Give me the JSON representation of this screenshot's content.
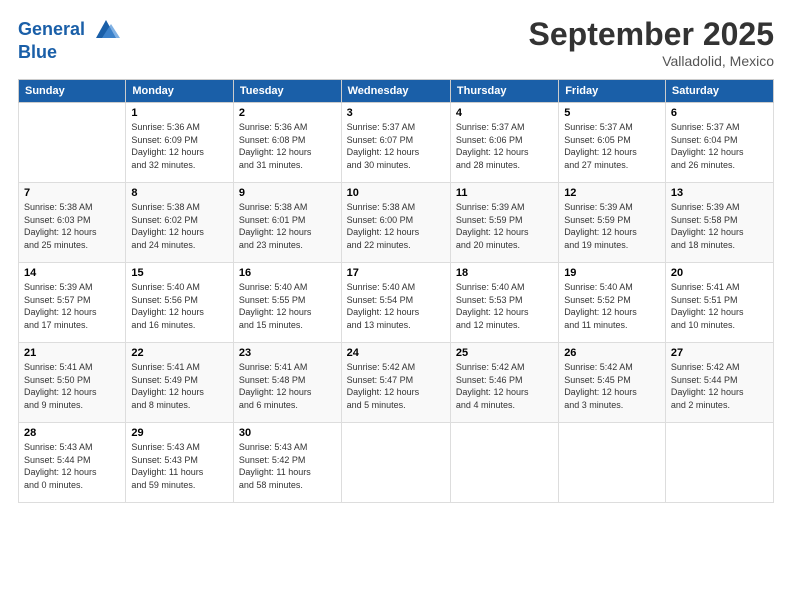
{
  "header": {
    "logo_line1": "General",
    "logo_line2": "Blue",
    "month": "September 2025",
    "location": "Valladolid, Mexico"
  },
  "days_of_week": [
    "Sunday",
    "Monday",
    "Tuesday",
    "Wednesday",
    "Thursday",
    "Friday",
    "Saturday"
  ],
  "weeks": [
    [
      {
        "day": "",
        "info": ""
      },
      {
        "day": "1",
        "info": "Sunrise: 5:36 AM\nSunset: 6:09 PM\nDaylight: 12 hours\nand 32 minutes."
      },
      {
        "day": "2",
        "info": "Sunrise: 5:36 AM\nSunset: 6:08 PM\nDaylight: 12 hours\nand 31 minutes."
      },
      {
        "day": "3",
        "info": "Sunrise: 5:37 AM\nSunset: 6:07 PM\nDaylight: 12 hours\nand 30 minutes."
      },
      {
        "day": "4",
        "info": "Sunrise: 5:37 AM\nSunset: 6:06 PM\nDaylight: 12 hours\nand 28 minutes."
      },
      {
        "day": "5",
        "info": "Sunrise: 5:37 AM\nSunset: 6:05 PM\nDaylight: 12 hours\nand 27 minutes."
      },
      {
        "day": "6",
        "info": "Sunrise: 5:37 AM\nSunset: 6:04 PM\nDaylight: 12 hours\nand 26 minutes."
      }
    ],
    [
      {
        "day": "7",
        "info": "Sunrise: 5:38 AM\nSunset: 6:03 PM\nDaylight: 12 hours\nand 25 minutes."
      },
      {
        "day": "8",
        "info": "Sunrise: 5:38 AM\nSunset: 6:02 PM\nDaylight: 12 hours\nand 24 minutes."
      },
      {
        "day": "9",
        "info": "Sunrise: 5:38 AM\nSunset: 6:01 PM\nDaylight: 12 hours\nand 23 minutes."
      },
      {
        "day": "10",
        "info": "Sunrise: 5:38 AM\nSunset: 6:00 PM\nDaylight: 12 hours\nand 22 minutes."
      },
      {
        "day": "11",
        "info": "Sunrise: 5:39 AM\nSunset: 5:59 PM\nDaylight: 12 hours\nand 20 minutes."
      },
      {
        "day": "12",
        "info": "Sunrise: 5:39 AM\nSunset: 5:59 PM\nDaylight: 12 hours\nand 19 minutes."
      },
      {
        "day": "13",
        "info": "Sunrise: 5:39 AM\nSunset: 5:58 PM\nDaylight: 12 hours\nand 18 minutes."
      }
    ],
    [
      {
        "day": "14",
        "info": "Sunrise: 5:39 AM\nSunset: 5:57 PM\nDaylight: 12 hours\nand 17 minutes."
      },
      {
        "day": "15",
        "info": "Sunrise: 5:40 AM\nSunset: 5:56 PM\nDaylight: 12 hours\nand 16 minutes."
      },
      {
        "day": "16",
        "info": "Sunrise: 5:40 AM\nSunset: 5:55 PM\nDaylight: 12 hours\nand 15 minutes."
      },
      {
        "day": "17",
        "info": "Sunrise: 5:40 AM\nSunset: 5:54 PM\nDaylight: 12 hours\nand 13 minutes."
      },
      {
        "day": "18",
        "info": "Sunrise: 5:40 AM\nSunset: 5:53 PM\nDaylight: 12 hours\nand 12 minutes."
      },
      {
        "day": "19",
        "info": "Sunrise: 5:40 AM\nSunset: 5:52 PM\nDaylight: 12 hours\nand 11 minutes."
      },
      {
        "day": "20",
        "info": "Sunrise: 5:41 AM\nSunset: 5:51 PM\nDaylight: 12 hours\nand 10 minutes."
      }
    ],
    [
      {
        "day": "21",
        "info": "Sunrise: 5:41 AM\nSunset: 5:50 PM\nDaylight: 12 hours\nand 9 minutes."
      },
      {
        "day": "22",
        "info": "Sunrise: 5:41 AM\nSunset: 5:49 PM\nDaylight: 12 hours\nand 8 minutes."
      },
      {
        "day": "23",
        "info": "Sunrise: 5:41 AM\nSunset: 5:48 PM\nDaylight: 12 hours\nand 6 minutes."
      },
      {
        "day": "24",
        "info": "Sunrise: 5:42 AM\nSunset: 5:47 PM\nDaylight: 12 hours\nand 5 minutes."
      },
      {
        "day": "25",
        "info": "Sunrise: 5:42 AM\nSunset: 5:46 PM\nDaylight: 12 hours\nand 4 minutes."
      },
      {
        "day": "26",
        "info": "Sunrise: 5:42 AM\nSunset: 5:45 PM\nDaylight: 12 hours\nand 3 minutes."
      },
      {
        "day": "27",
        "info": "Sunrise: 5:42 AM\nSunset: 5:44 PM\nDaylight: 12 hours\nand 2 minutes."
      }
    ],
    [
      {
        "day": "28",
        "info": "Sunrise: 5:43 AM\nSunset: 5:44 PM\nDaylight: 12 hours\nand 0 minutes."
      },
      {
        "day": "29",
        "info": "Sunrise: 5:43 AM\nSunset: 5:43 PM\nDaylight: 11 hours\nand 59 minutes."
      },
      {
        "day": "30",
        "info": "Sunrise: 5:43 AM\nSunset: 5:42 PM\nDaylight: 11 hours\nand 58 minutes."
      },
      {
        "day": "",
        "info": ""
      },
      {
        "day": "",
        "info": ""
      },
      {
        "day": "",
        "info": ""
      },
      {
        "day": "",
        "info": ""
      }
    ]
  ]
}
